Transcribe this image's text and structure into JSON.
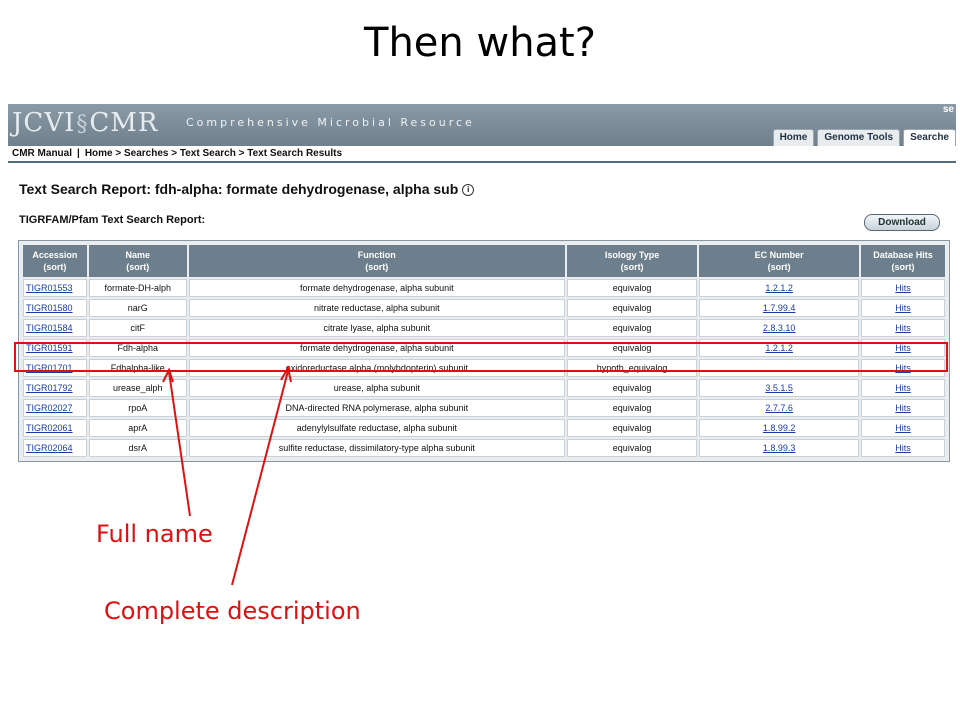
{
  "slide": {
    "title": "Then what?"
  },
  "site": {
    "logo_left": "JCVI",
    "logo_right": "CMR",
    "tagline": "Comprehensive Microbial Resource",
    "corner_text": "se",
    "tabs": [
      "Home",
      "Genome Tools",
      "Searche"
    ],
    "manual": "CMR Manual",
    "breadcrumb": "Home > Searches > Text Search > Text Search Results"
  },
  "report": {
    "title": "Text Search Report: fdh-alpha: formate dehydrogenase, alpha sub",
    "subtitle": "TIGRFAM/Pfam Text Search Report:",
    "download_label": "Download"
  },
  "table": {
    "sort_label": "(sort)",
    "headers": [
      "Accession",
      "Name",
      "Function",
      "Isology Type",
      "EC Number",
      "Database Hits"
    ],
    "rows": [
      [
        "TIGR01553",
        "formate-DH-alph",
        "formate dehydrogenase, alpha subunit",
        "equivalog",
        "1.2.1.2",
        "Hits"
      ],
      [
        "TIGR01580",
        "narG",
        "nitrate reductase, alpha subunit",
        "equivalog",
        "1.7.99.4",
        "Hits"
      ],
      [
        "TIGR01584",
        "citF",
        "citrate lyase, alpha subunit",
        "equivalog",
        "2.8.3.10",
        "Hits"
      ],
      [
        "TIGR01591",
        "Fdh-alpha",
        "formate dehydrogenase, alpha subunit",
        "equivalog",
        "1.2.1.2",
        "Hits"
      ],
      [
        "TIGR01701",
        "Fdhalpha-like",
        "oxidoreductase alpha (molybdopterin) subunit",
        "hypoth_equivalog",
        "",
        "Hits"
      ],
      [
        "TIGR01792",
        "urease_alph",
        "urease, alpha subunit",
        "equivalog",
        "3.5.1.5",
        "Hits"
      ],
      [
        "TIGR02027",
        "rpoA",
        "DNA-directed RNA polymerase, alpha subunit",
        "equivalog",
        "2.7.7.6",
        "Hits"
      ],
      [
        "TIGR02061",
        "aprA",
        "adenylylsulfate reductase, alpha subunit",
        "equivalog",
        "1.8.99.2",
        "Hits"
      ],
      [
        "TIGR02064",
        "dsrA",
        "sulfite reductase, dissimilatory-type alpha subunit",
        "equivalog",
        "1.8.99.3",
        "Hits"
      ]
    ]
  },
  "annotations": {
    "full_name": "Full name",
    "complete_description": "Complete description",
    "highlight_color": "#e01010"
  }
}
